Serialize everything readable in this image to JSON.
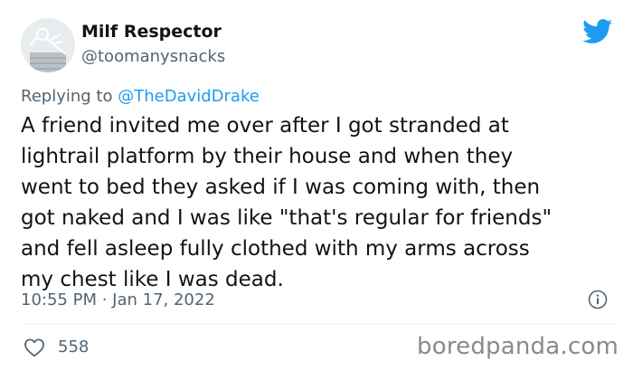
{
  "author": {
    "display_name": "Milf Respector",
    "handle": "@toomanysnacks",
    "avatar_icon": "skeleton-avatar-icon"
  },
  "platform_icon": "twitter-bird-icon",
  "brand_color": "#1d9bf0",
  "reply": {
    "prefix": "Replying to",
    "mention": "@TheDavidDrake"
  },
  "tweet": {
    "lines": [
      "A friend invited me over after I got stranded at",
      "lightrail platform by their house and when they",
      "went to bed they asked if I was coming with, then",
      "got naked and I was like \"that's regular for friends\"",
      "and fell asleep fully clothed with my arms across",
      "my chest like I was dead."
    ],
    "timestamp": "10:55 PM · Jan 17, 2022"
  },
  "engagement": {
    "likes": "558"
  },
  "watermark": "boredpanda.com"
}
